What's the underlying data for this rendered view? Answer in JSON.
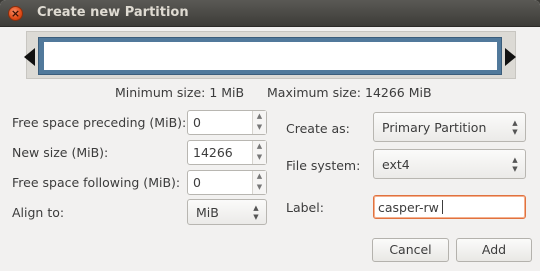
{
  "window": {
    "title": "Create new Partition",
    "close_glyph": "×"
  },
  "sizes": {
    "minimum": "Minimum size: 1 MiB",
    "maximum": "Maximum size: 14266 MiB"
  },
  "fields": {
    "free_space_preceding": {
      "label": "Free space preceding (MiB):",
      "value": "0"
    },
    "new_size": {
      "label": "New size (MiB):",
      "value": "14266"
    },
    "free_space_following": {
      "label": "Free space following (MiB):",
      "value": "0"
    },
    "align_to": {
      "label": "Align to:",
      "value": "MiB"
    },
    "create_as": {
      "label": "Create as:",
      "value": "Primary Partition"
    },
    "file_system": {
      "label": "File system:",
      "value": "ext4"
    },
    "partition_label": {
      "label": "Label:",
      "value": "casper-rw"
    }
  },
  "buttons": {
    "cancel": "Cancel",
    "add": "Add"
  },
  "icons": {
    "spin_up": "▲",
    "spin_down": "▼",
    "close": "close-icon"
  },
  "colors": {
    "partition_bar": "#51799b",
    "focus_border": "#e0723f",
    "close_button": "#df4a16"
  }
}
